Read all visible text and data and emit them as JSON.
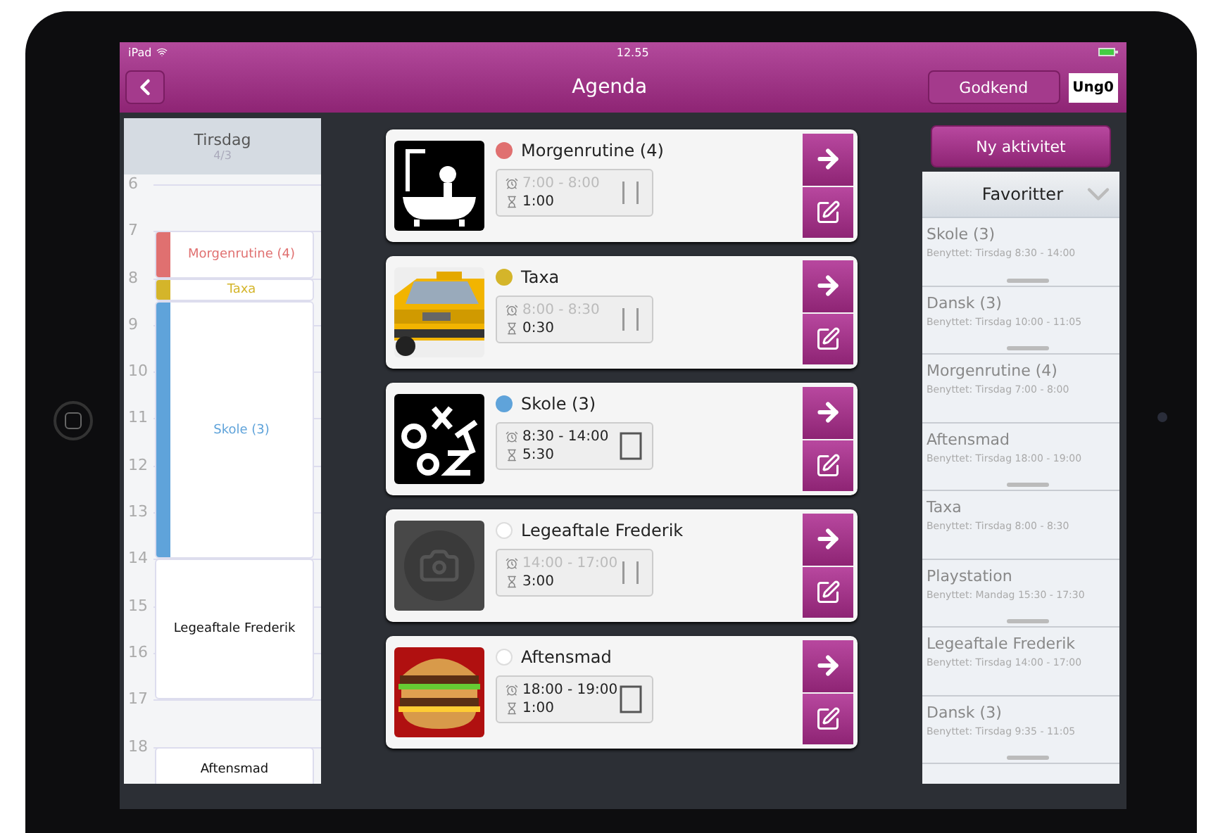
{
  "status_bar": {
    "device": "iPad",
    "time": "12.55"
  },
  "nav_bar": {
    "title": "Agenda",
    "approve_button": "Godkend",
    "user_badge": "Ung0"
  },
  "calendar": {
    "day": "Tirsdag",
    "date": "4/3",
    "hours": [
      "6",
      "7",
      "8",
      "9",
      "10",
      "11",
      "12",
      "13",
      "14",
      "15",
      "16",
      "17",
      "18"
    ],
    "events": [
      {
        "title": "Morgenrutine (4)",
        "color": "#e07070"
      },
      {
        "title": "Taxa",
        "color": "#d4b52a"
      },
      {
        "title": "Skole (3)",
        "color": "#5fa3da"
      },
      {
        "title": "Legeaftale Frederik"
      },
      {
        "title": "Aftensmad"
      }
    ]
  },
  "activities": [
    {
      "title": "Morgenrutine (4)",
      "color": "#e07070",
      "kind": "picture",
      "time_range": "7:00 - 8:00",
      "past": true,
      "duration": "1:00",
      "paused": true
    },
    {
      "title": "Taxa",
      "color": "#d4b52a",
      "kind": "picture",
      "time_range": "8:00 - 8:30",
      "past": true,
      "duration": "0:30",
      "paused": true
    },
    {
      "title": "Skole (3)",
      "color": "#5fa3da",
      "kind": "picture",
      "time_range": "8:30 - 14:00",
      "past": false,
      "duration": "5:30",
      "paused": false
    },
    {
      "title": "Legeaftale Frederik",
      "kind": "placeholder",
      "time_range": "14:00 - 17:00",
      "past": true,
      "duration": "3:00",
      "paused": true
    },
    {
      "title": "Aftensmad",
      "kind": "picture",
      "time_range": "18:00 - 19:00",
      "past": false,
      "duration": "1:00",
      "paused": false
    }
  ],
  "sidebar": {
    "new_button": "Ny aktivitet",
    "favorites_title": "Favoritter",
    "favorites": [
      {
        "name": "Skole (3)",
        "used": "Benyttet: Tirsdag 8:30 - 14:00",
        "handle": true
      },
      {
        "name": "Dansk (3)",
        "used": "Benyttet: Tirsdag 10:00 - 11:05",
        "handle": true
      },
      {
        "name": "Morgenrutine (4)",
        "used": "Benyttet: Tirsdag 7:00 - 8:00",
        "handle": false
      },
      {
        "name": "Aftensmad",
        "used": "Benyttet: Tirsdag 18:00 - 19:00",
        "handle": true
      },
      {
        "name": "Taxa",
        "used": "Benyttet: Tirsdag 8:00 - 8:30",
        "handle": false
      },
      {
        "name": "Playstation",
        "used": "Benyttet: Mandag 15:30 - 17:30",
        "handle": true
      },
      {
        "name": "Legeaftale Frederik",
        "used": "Benyttet: Tirsdag 14:00 - 17:00",
        "handle": false
      },
      {
        "name": "Dansk (3)",
        "used": "Benyttet: Tirsdag 9:35 - 11:05",
        "handle": true
      }
    ]
  }
}
